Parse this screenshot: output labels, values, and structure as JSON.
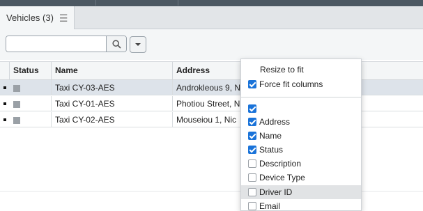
{
  "tab": {
    "label": "Vehicles (3)",
    "menu_icon": "hamburger-menu-icon"
  },
  "toolbar": {
    "search_value": "",
    "search_icon": "magnifier-icon",
    "dropdown_icon": "chevron-down-icon"
  },
  "grid": {
    "columns": [
      {
        "label": "Status"
      },
      {
        "label": "Name"
      },
      {
        "label": "Address"
      }
    ],
    "rows": [
      {
        "status_color": "#9aa0a6",
        "name": "Taxi CY-03-AES",
        "address": "Androkleous 9, N",
        "selected": true
      },
      {
        "status_color": "#9aa0a6",
        "name": "Taxi CY-01-AES",
        "address": "Photiou Street, N",
        "selected": false
      },
      {
        "status_color": "#9aa0a6",
        "name": "Taxi CY-02-AES",
        "address": "Mouseiou 1, Nic",
        "selected": false
      }
    ]
  },
  "column_menu": {
    "resize_label": "Resize to fit",
    "force_fit_label": "Force fit columns",
    "force_fit_checked": true,
    "select_all_checked": true,
    "columns": [
      {
        "label": "Address",
        "checked": true
      },
      {
        "label": "Name",
        "checked": true
      },
      {
        "label": "Status",
        "checked": true
      },
      {
        "label": "Description",
        "checked": false
      },
      {
        "label": "Device Type",
        "checked": false
      },
      {
        "label": "Driver ID",
        "checked": false,
        "highlighted": true
      },
      {
        "label": "Email",
        "checked": false
      }
    ]
  }
}
